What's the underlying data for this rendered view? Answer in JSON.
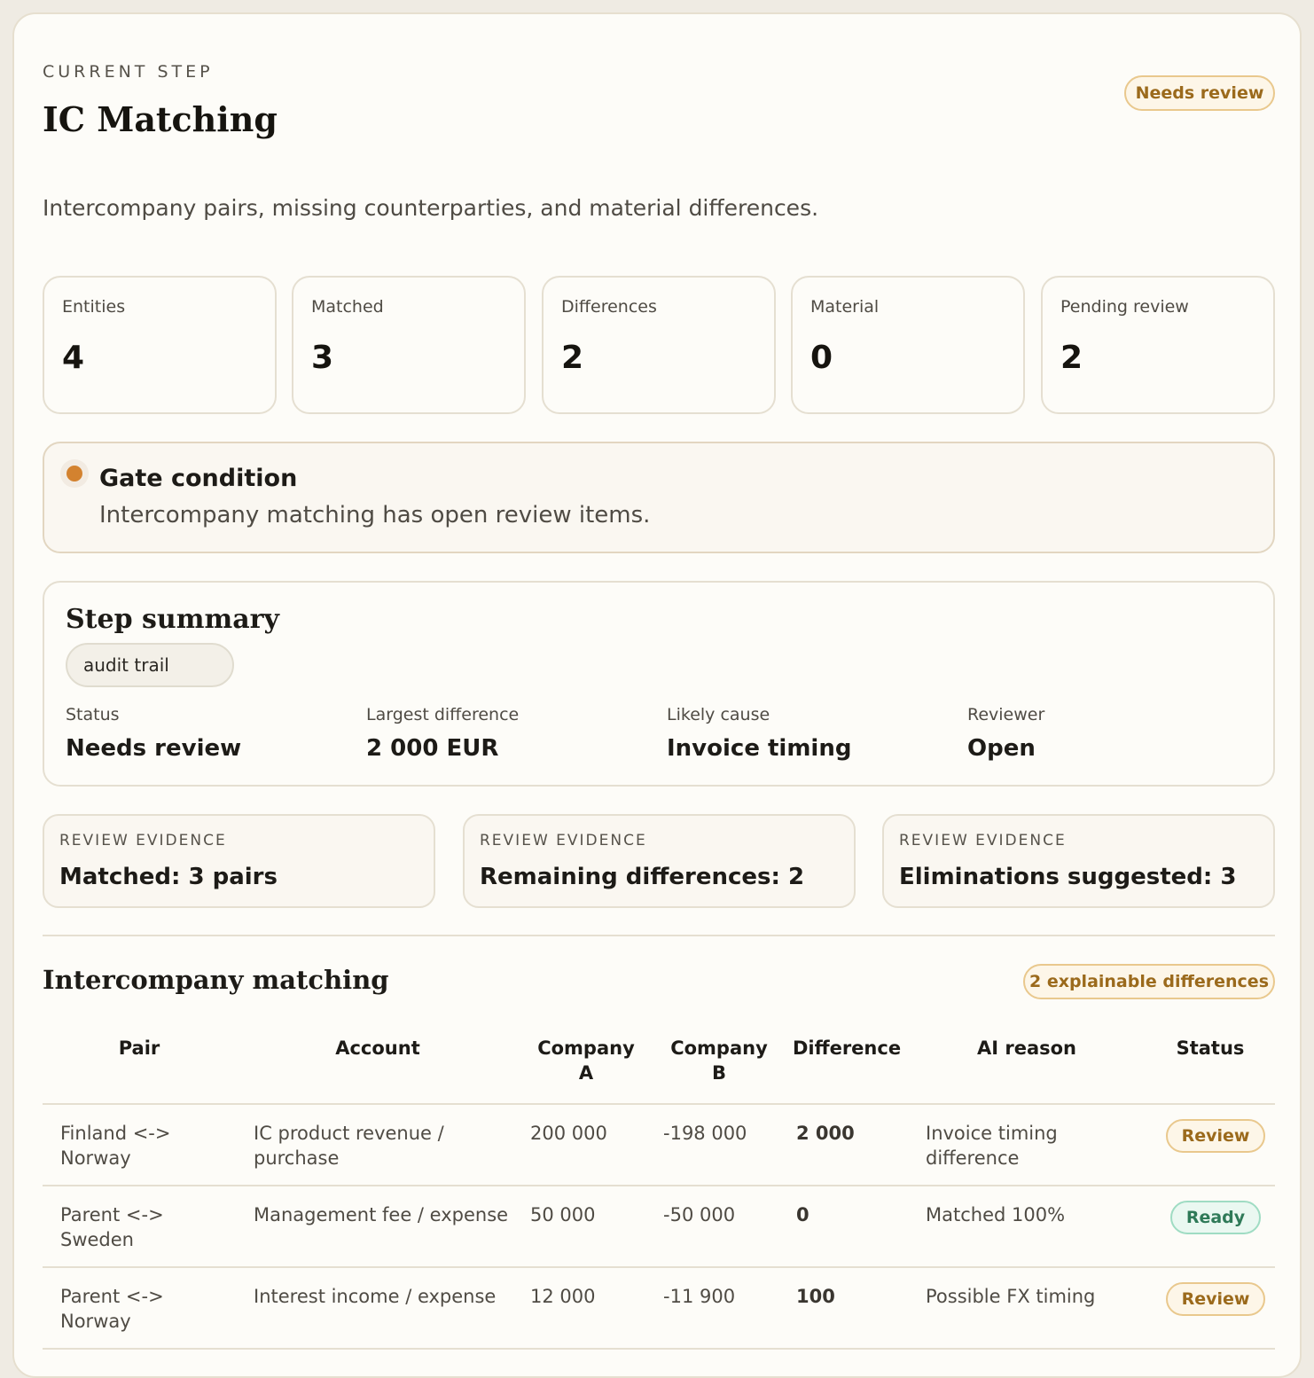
{
  "header": {
    "eyebrow": "CURRENT STEP",
    "title": "IC Matching",
    "status_pill": "Needs review",
    "description": "Intercompany pairs, missing counterparties, and material differences."
  },
  "metrics": [
    {
      "label": "Entities",
      "value": "4"
    },
    {
      "label": "Matched",
      "value": "3"
    },
    {
      "label": "Differences",
      "value": "2"
    },
    {
      "label": "Material",
      "value": "0"
    },
    {
      "label": "Pending review",
      "value": "2"
    }
  ],
  "gate": {
    "title": "Gate condition",
    "text": "Intercompany matching has open review items.",
    "dot_color": "#d3822f"
  },
  "summary": {
    "title": "Step summary",
    "chip": "audit trail",
    "columns": [
      {
        "label": "Status",
        "value": "Needs review"
      },
      {
        "label": "Largest difference",
        "value": "2 000 EUR"
      },
      {
        "label": "Likely cause",
        "value": "Invoice timing"
      },
      {
        "label": "Reviewer",
        "value": "Open"
      }
    ]
  },
  "evidence": [
    {
      "label": "REVIEW EVIDENCE",
      "value": "Matched: 3 pairs"
    },
    {
      "label": "REVIEW EVIDENCE",
      "value": "Remaining differences: 2"
    },
    {
      "label": "REVIEW EVIDENCE",
      "value": "Eliminations suggested: 3"
    }
  ],
  "matching": {
    "title": "Intercompany matching",
    "pill": "2 explainable differences",
    "headers": {
      "pair": "Pair",
      "account": "Account",
      "company_a": "Company A",
      "company_b": "Company B",
      "difference": "Difference",
      "ai_reason": "AI reason",
      "status": "Status"
    },
    "rows": [
      {
        "pair": "Finland <-> Norway",
        "account": "IC product revenue / purchase",
        "company_a": "200 000",
        "company_b": "-198 000",
        "difference": "2 000",
        "ai_reason": "Invoice timing difference",
        "status": "Review"
      },
      {
        "pair": "Parent <-> Sweden",
        "account": "Management fee / expense",
        "company_a": "50 000",
        "company_b": "-50 000",
        "difference": "0",
        "ai_reason": "Matched 100%",
        "status": "Ready"
      },
      {
        "pair": "Parent <-> Norway",
        "account": "Interest income / expense",
        "company_a": "12 000",
        "company_b": "-11 900",
        "difference": "100",
        "ai_reason": "Possible FX timing",
        "status": "Review"
      }
    ]
  },
  "colors": {
    "accent_warning": "#9b6a1c",
    "accent_ready": "#2f7a58",
    "background": "#fdfcf8"
  }
}
